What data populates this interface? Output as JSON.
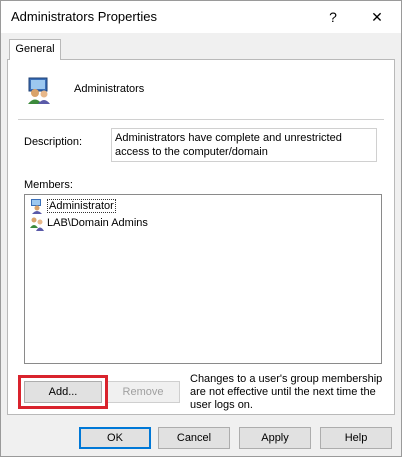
{
  "window": {
    "title": "Administrators Properties",
    "help_label": "?",
    "close_label": "✕"
  },
  "tabs": [
    {
      "label": "General"
    }
  ],
  "general": {
    "group_name": "Administrators",
    "description_label": "Description:",
    "description_value": "Administrators have complete and unrestricted access to the computer/domain",
    "members_label": "Members:",
    "members": [
      {
        "name": "Administrator",
        "icon": "user-icon",
        "selected": true
      },
      {
        "name": "LAB\\Domain Admins",
        "icon": "group-icon",
        "selected": false
      }
    ],
    "add_label": "Add...",
    "remove_label": "Remove",
    "note": "Changes to a user's group membership are not effective until the next time the user logs on."
  },
  "footer": {
    "ok_label": "OK",
    "cancel_label": "Cancel",
    "apply_label": "Apply",
    "help_label": "Help"
  },
  "colors": {
    "highlight": "#d9232d",
    "default_button_border": "#0078d7"
  }
}
